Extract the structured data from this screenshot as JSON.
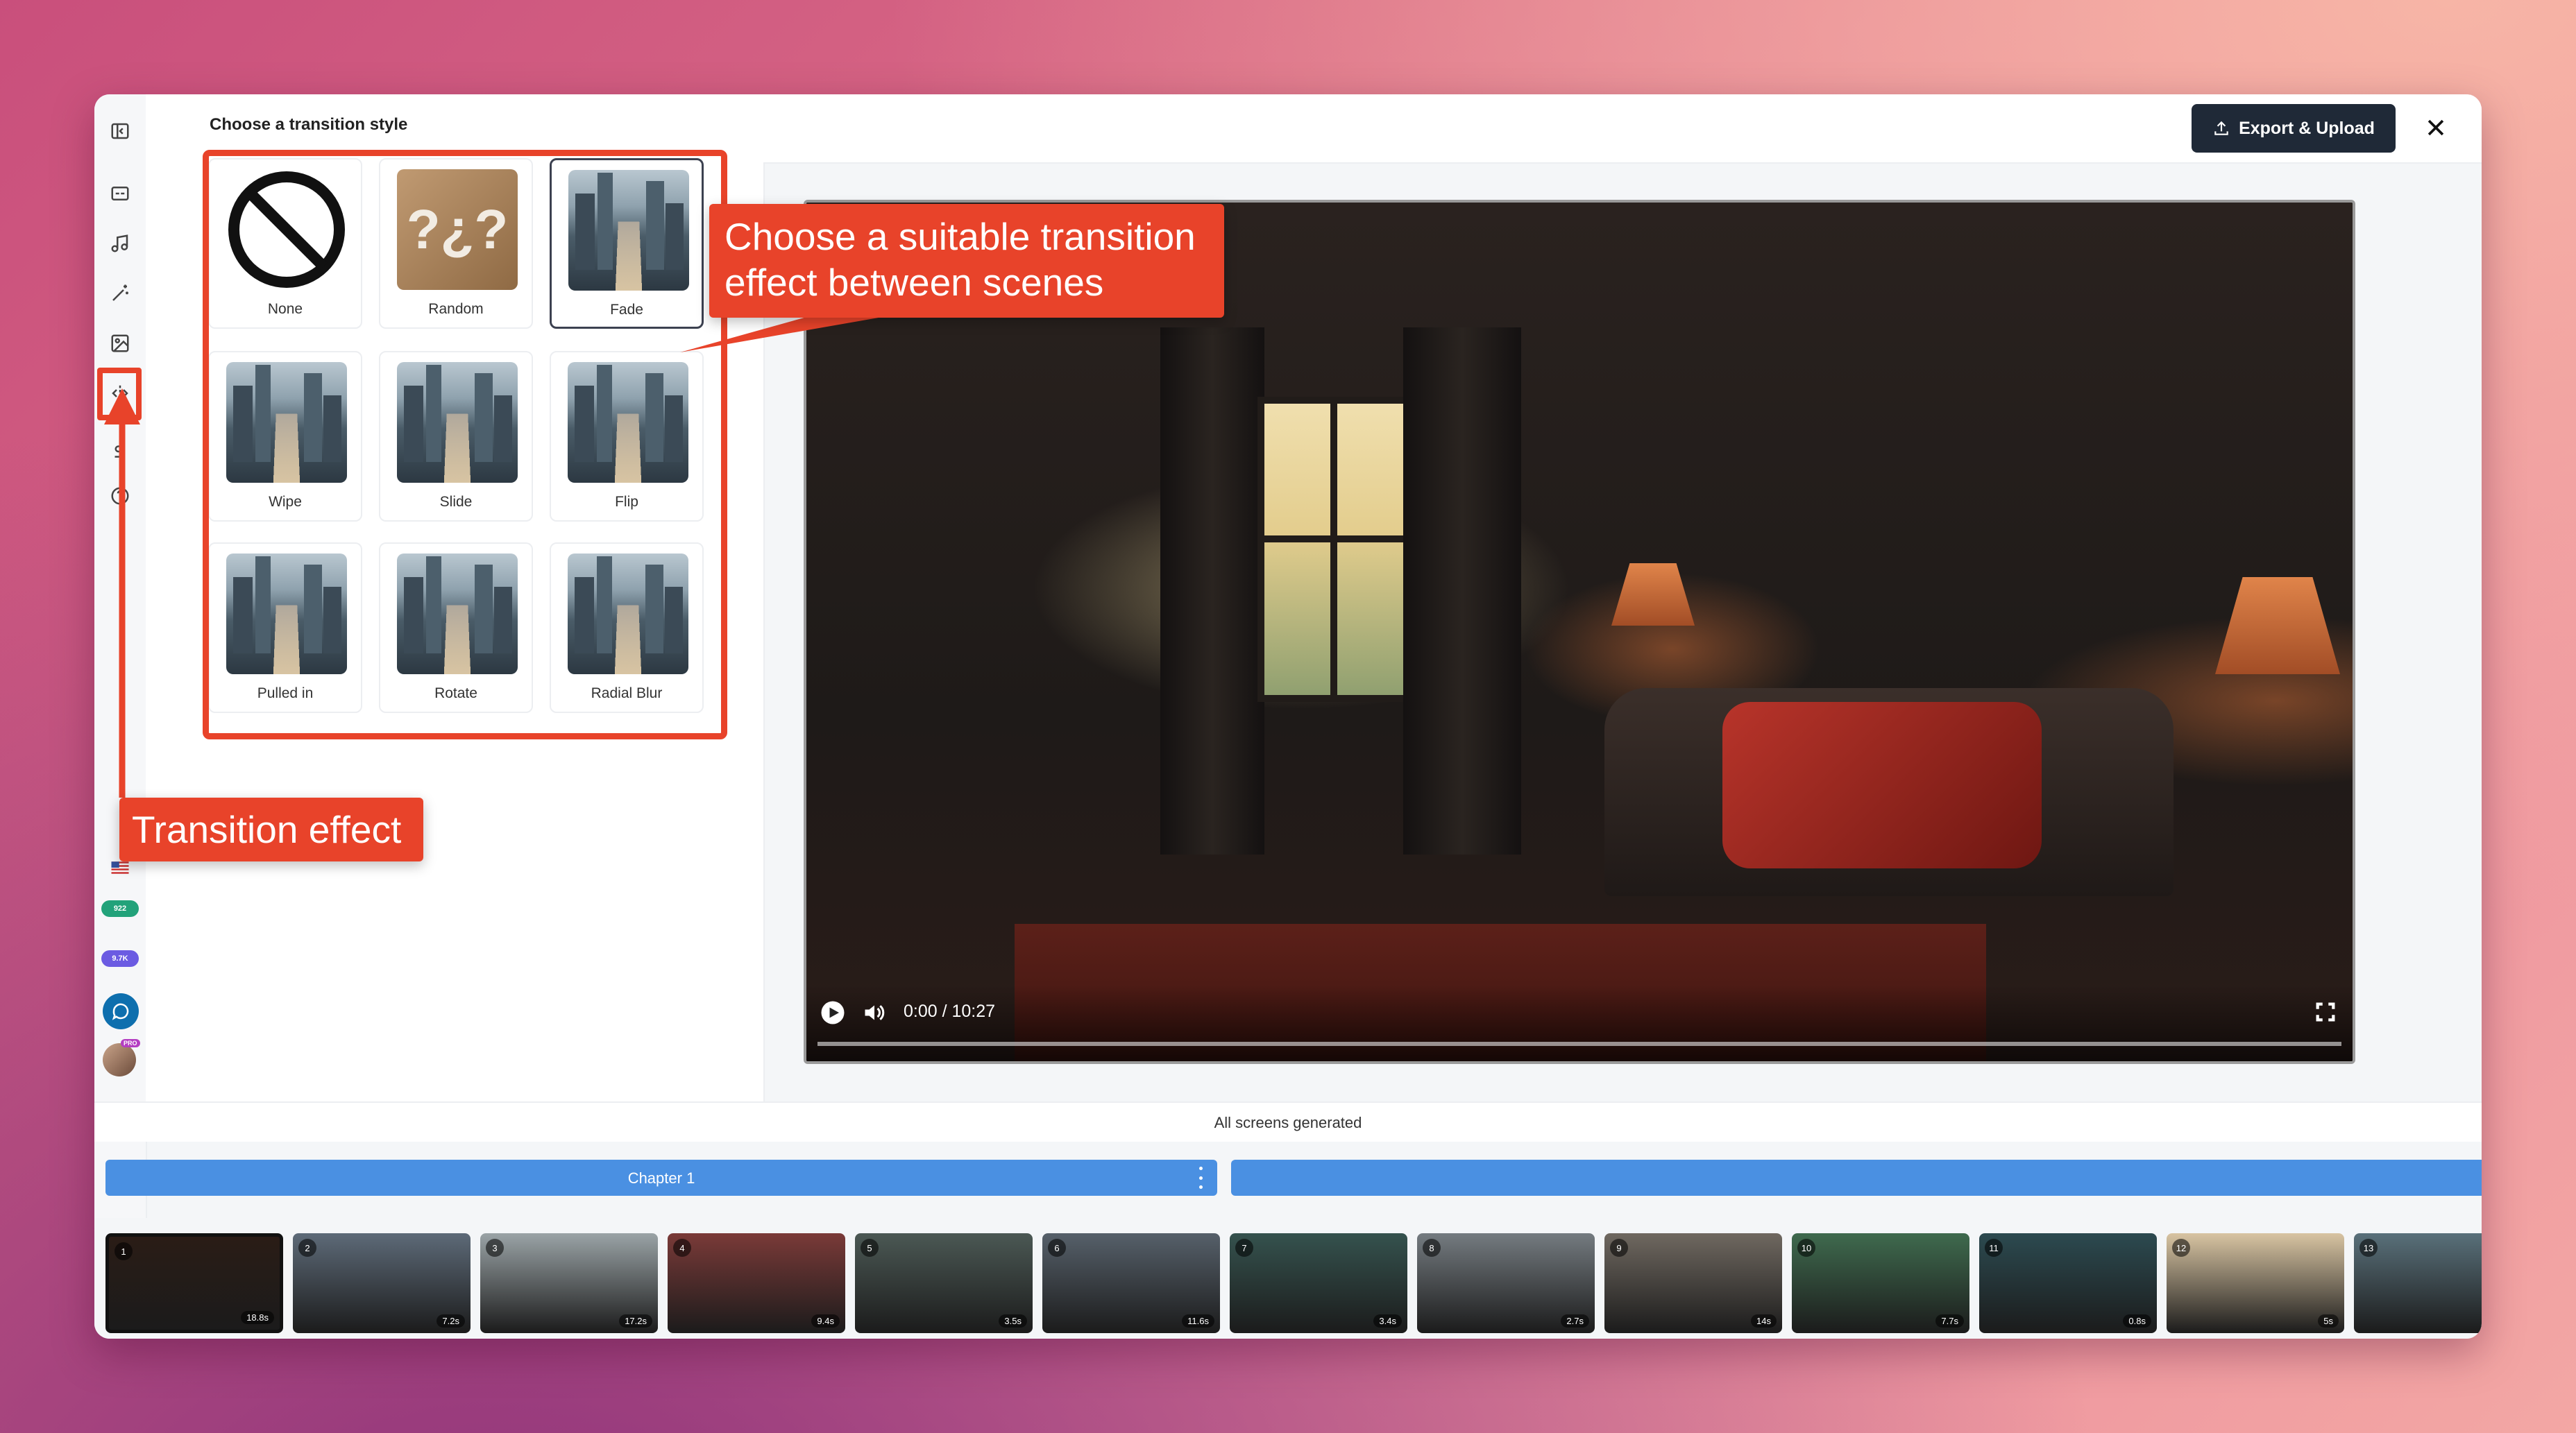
{
  "side_panel": {
    "title": "Choose a transition style",
    "transitions": [
      {
        "label": "None",
        "icon": "prohibited-icon",
        "selected": false
      },
      {
        "label": "Random",
        "icon": "question-marks-icon",
        "selected": false
      },
      {
        "label": "Fade",
        "icon": "city-thumbnail",
        "selected": true
      },
      {
        "label": "Wipe",
        "icon": "city-thumbnail",
        "selected": false
      },
      {
        "label": "Slide",
        "icon": "city-thumbnail",
        "selected": false
      },
      {
        "label": "Flip",
        "icon": "city-thumbnail",
        "selected": false
      },
      {
        "label": "Pulled in",
        "icon": "city-thumbnail",
        "selected": false
      },
      {
        "label": "Rotate",
        "icon": "city-thumbnail",
        "selected": false
      },
      {
        "label": "Radial Blur",
        "icon": "city-thumbnail",
        "selected": false
      }
    ]
  },
  "rail": {
    "badges": [
      {
        "text": "922",
        "color": "#22a27a"
      },
      {
        "text": "9.7K",
        "color": "#6b5be2"
      }
    ],
    "pro_badge": "PRO"
  },
  "header": {
    "export_label": "Export & Upload"
  },
  "player": {
    "time": "0:00 / 10:27",
    "progress": 0.0
  },
  "status": {
    "text": "All screens generated"
  },
  "chapters": [
    {
      "label": "Chapter 1"
    },
    {
      "label": ""
    }
  ],
  "timeline": {
    "clips": [
      {
        "number": "1",
        "duration": "18.8s",
        "selected": true,
        "color": "#2a1c16"
      },
      {
        "number": "2",
        "duration": "7.2s",
        "selected": false,
        "color": "#5d6a78"
      },
      {
        "number": "3",
        "duration": "17.2s",
        "selected": false,
        "color": "#9aa3a6"
      },
      {
        "number": "4",
        "duration": "9.4s",
        "selected": false,
        "color": "#7a3a38"
      },
      {
        "number": "5",
        "duration": "3.5s",
        "selected": false,
        "color": "#4b5854"
      },
      {
        "number": "6",
        "duration": "11.6s",
        "selected": false,
        "color": "#56606a"
      },
      {
        "number": "7",
        "duration": "3.4s",
        "selected": false,
        "color": "#35524e"
      },
      {
        "number": "8",
        "duration": "2.7s",
        "selected": false,
        "color": "#747b80"
      },
      {
        "number": "9",
        "duration": "14s",
        "selected": false,
        "color": "#6f6860"
      },
      {
        "number": "10",
        "duration": "7.7s",
        "selected": false,
        "color": "#3f6a4e"
      },
      {
        "number": "11",
        "duration": "0.8s",
        "selected": false,
        "color": "#2c4a50"
      },
      {
        "number": "12",
        "duration": "5s",
        "selected": false,
        "color": "#d8c4a2"
      },
      {
        "number": "13",
        "duration": "",
        "selected": false,
        "color": "#59707a"
      }
    ]
  },
  "annotations": {
    "scene_callout": "Choose a suitable transition effect between scenes",
    "rail_callout": "Transition effect",
    "accent": "#e8432a"
  }
}
